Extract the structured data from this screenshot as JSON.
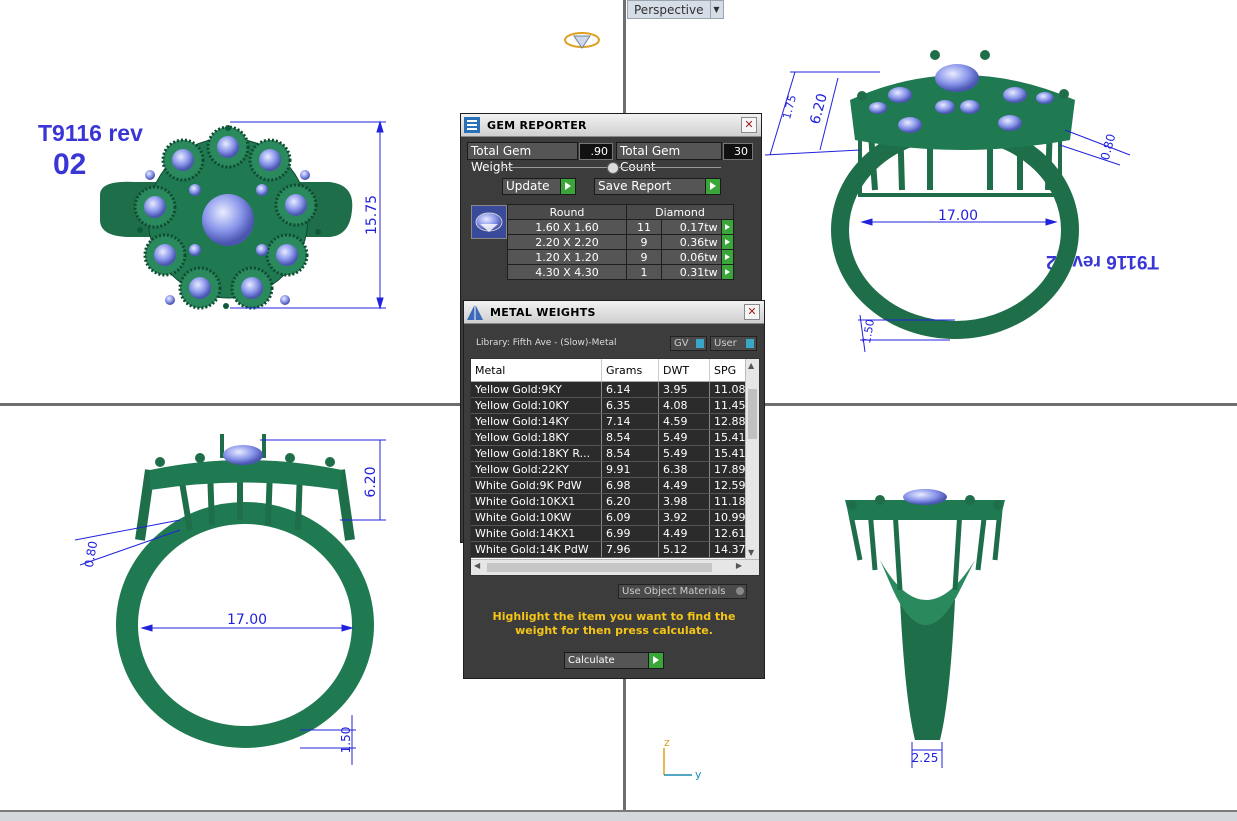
{
  "viewport": {
    "perspective_label": "Perspective",
    "dropdown_glyph": "▼"
  },
  "ring_label": {
    "line1": "T9116 rev",
    "line2": "02",
    "mirrored": "T9116 rev 02"
  },
  "dimensions": {
    "top_view_height": "15.75",
    "persp_shank": "17.00",
    "persp_height": "6.20",
    "persp_band": "1.75",
    "persp_wire": "0.80",
    "persp_bottom": "1.50",
    "front_height": "6.20",
    "front_wire": "0.80",
    "front_shank": "17.00",
    "front_bottom": "1.50",
    "side_band": "2.25"
  },
  "axes": {
    "z": "z",
    "y": "y"
  },
  "gem_reporter": {
    "title": "GEM REPORTER",
    "total_weight_label": "Total Gem Weight",
    "total_weight_value": ".90",
    "total_count_label": "Total Gem Count",
    "total_count_value": "30",
    "update_label": "Update",
    "save_label": "Save Report",
    "header_shape": "Round",
    "header_type": "Diamond",
    "rows": [
      {
        "size": "1.60 X 1.60",
        "count": "11",
        "weight": "0.17tw"
      },
      {
        "size": "2.20 X 2.20",
        "count": "9",
        "weight": "0.36tw"
      },
      {
        "size": "1.20 X 1.20",
        "count": "9",
        "weight": "0.06tw"
      },
      {
        "size": "4.30 X 4.30",
        "count": "1",
        "weight": "0.31tw"
      }
    ]
  },
  "metal_weights": {
    "title": "METAL WEIGHTS",
    "library": "Library: Fifth Ave - (Slow)-Metal",
    "gv_label": "GV",
    "user_label": "User",
    "columns": [
      "Metal",
      "Grams",
      "DWT",
      "SPG"
    ],
    "rows": [
      [
        "Yellow Gold:9KY",
        "6.14",
        "3.95",
        "11.08"
      ],
      [
        "Yellow Gold:10KY",
        "6.35",
        "4.08",
        "11.45"
      ],
      [
        "Yellow Gold:14KY",
        "7.14",
        "4.59",
        "12.88"
      ],
      [
        "Yellow Gold:18KY",
        "8.54",
        "5.49",
        "15.41"
      ],
      [
        "Yellow Gold:18KY R...",
        "8.54",
        "5.49",
        "15.41"
      ],
      [
        "Yellow Gold:22KY",
        "9.91",
        "6.38",
        "17.89"
      ],
      [
        "White Gold:9K PdW",
        "6.98",
        "4.49",
        "12.59"
      ],
      [
        "White Gold:10KX1",
        "6.20",
        "3.98",
        "11.18"
      ],
      [
        "White Gold:10KW",
        "6.09",
        "3.92",
        "10.99"
      ],
      [
        "White Gold:14KX1",
        "6.99",
        "4.49",
        "12.61"
      ],
      [
        "White Gold:14K PdW",
        "7.96",
        "5.12",
        "14.37"
      ]
    ],
    "use_object_materials": "Use Object Materials",
    "note": "Highlight the item you want to find the weight for then press calculate.",
    "calculate_label": "Calculate"
  },
  "colors": {
    "ring_green": "#1f7a52",
    "gem_blue": "#7f8fe8",
    "dim_blue": "#2222dd",
    "label_blue": "#3a36d6",
    "note_yellow": "#f5c518"
  }
}
